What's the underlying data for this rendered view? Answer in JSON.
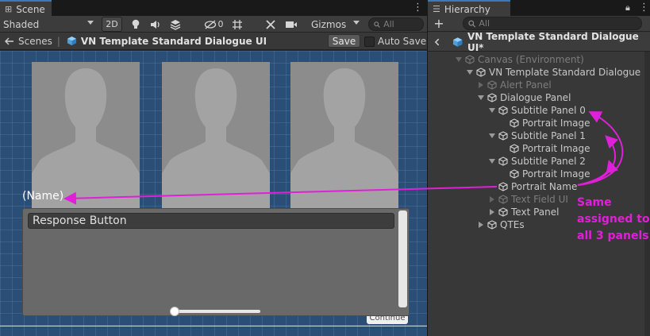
{
  "scene": {
    "tab_label": "Scene",
    "toolbar": {
      "shading": "Shaded",
      "mode_2d": "2D",
      "hidden_count": "0",
      "gizmos": "Gizmos",
      "search_placeholder": "All"
    },
    "breadcrumb": {
      "root": "Scenes",
      "current": "VN Template Standard Dialogue UI"
    },
    "save_label": "Save",
    "auto_save_label": "Auto Save",
    "viewport": {
      "name_label": "(Name)",
      "response_button": "Response Button",
      "continue_label": "Continue"
    }
  },
  "hierarchy": {
    "tab_label": "Hierarchy",
    "search_placeholder": "All",
    "breadcrumb": "VN Template Standard Dialogue UI*",
    "tree": [
      {
        "label": "Canvas (Environment)",
        "depth": 0,
        "expand": "open",
        "dim": true
      },
      {
        "label": "VN Template Standard Dialogue UI",
        "depth": 1,
        "expand": "open",
        "dim": false
      },
      {
        "label": "Alert Panel",
        "depth": 2,
        "expand": "closed",
        "dim": true
      },
      {
        "label": "Dialogue Panel",
        "depth": 2,
        "expand": "open",
        "dim": false
      },
      {
        "label": "Subtitle Panel 0",
        "depth": 3,
        "expand": "open",
        "dim": false
      },
      {
        "label": "Portrait Image",
        "depth": 4,
        "expand": "none",
        "dim": false
      },
      {
        "label": "Subtitle Panel 1",
        "depth": 3,
        "expand": "open",
        "dim": false
      },
      {
        "label": "Portrait Image",
        "depth": 4,
        "expand": "none",
        "dim": false
      },
      {
        "label": "Subtitle Panel 2",
        "depth": 3,
        "expand": "open",
        "dim": false
      },
      {
        "label": "Portrait Image",
        "depth": 4,
        "expand": "none",
        "dim": false
      },
      {
        "label": "Portrait Name",
        "depth": 3,
        "expand": "none",
        "dim": false
      },
      {
        "label": "Text Field UI",
        "depth": 3,
        "expand": "closed",
        "dim": true
      },
      {
        "label": "Text Panel",
        "depth": 3,
        "expand": "closed",
        "dim": false
      },
      {
        "label": "QTEs",
        "depth": 2,
        "expand": "closed",
        "dim": false
      }
    ]
  },
  "annotation": {
    "lines": [
      "Same",
      "assigned to",
      "all 3 panels"
    ],
    "color": "#e020d8"
  },
  "colors": {
    "accent": "#3a79bb",
    "scene_background": "#2a4e75",
    "cube_blue": "#5aaee8"
  }
}
